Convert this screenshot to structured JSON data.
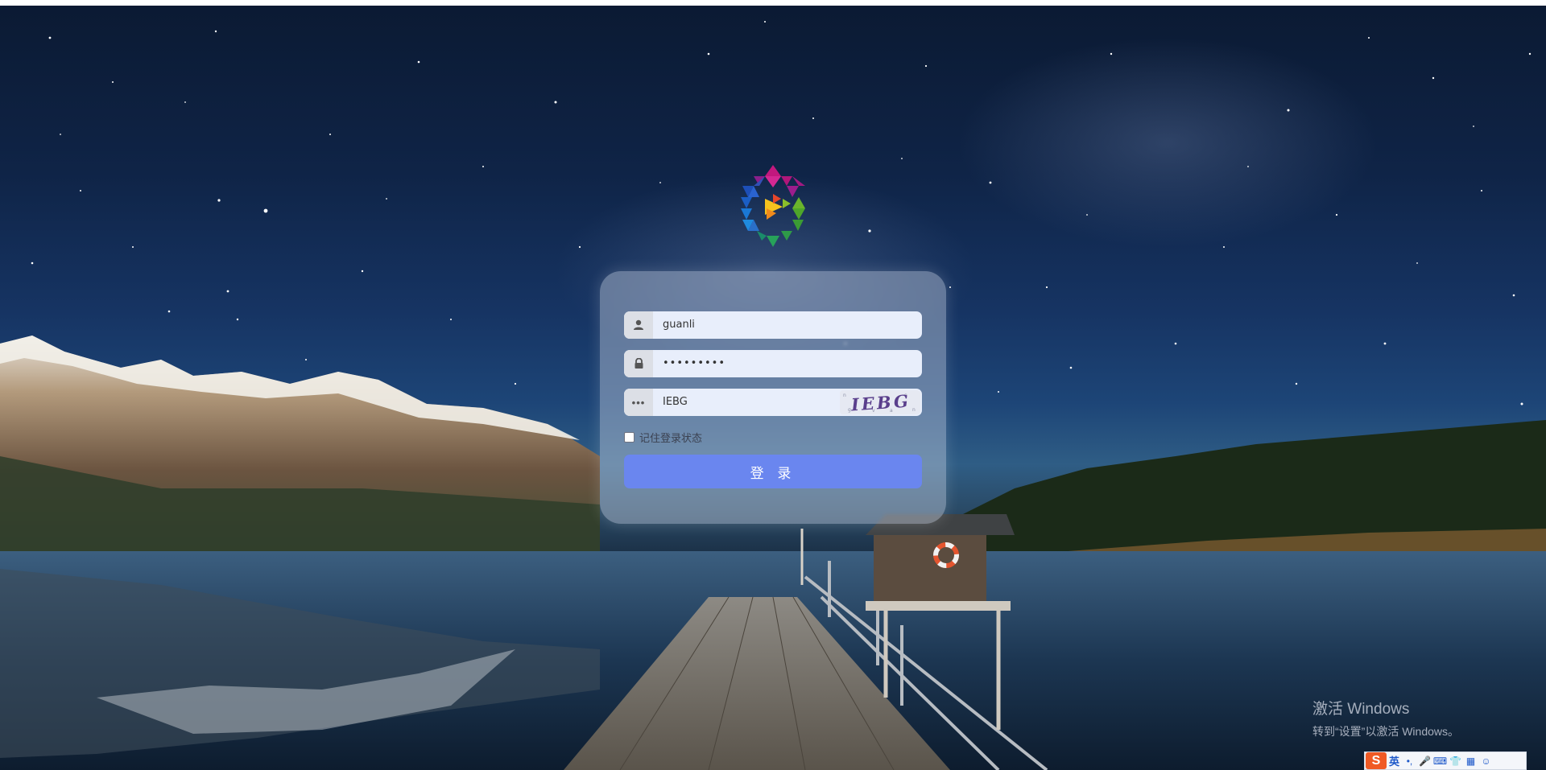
{
  "login": {
    "username_value": "guanli",
    "password_value": "•••••••••",
    "captcha_value": "IEBG",
    "captcha_image_text": "IEBG",
    "remember_label": "记住登录状态",
    "login_button_label": "登 录"
  },
  "watermark": {
    "line1": "激活 Windows",
    "line2": "转到“设置”以激活 Windows。"
  },
  "ime": {
    "logo": "S",
    "mode": "英",
    "items": [
      "•,",
      "🎤",
      "⌨",
      "👕",
      "▦",
      "☺"
    ]
  },
  "colors": {
    "login_button": "#6a86ef",
    "ime_logo": "#f05a24"
  }
}
